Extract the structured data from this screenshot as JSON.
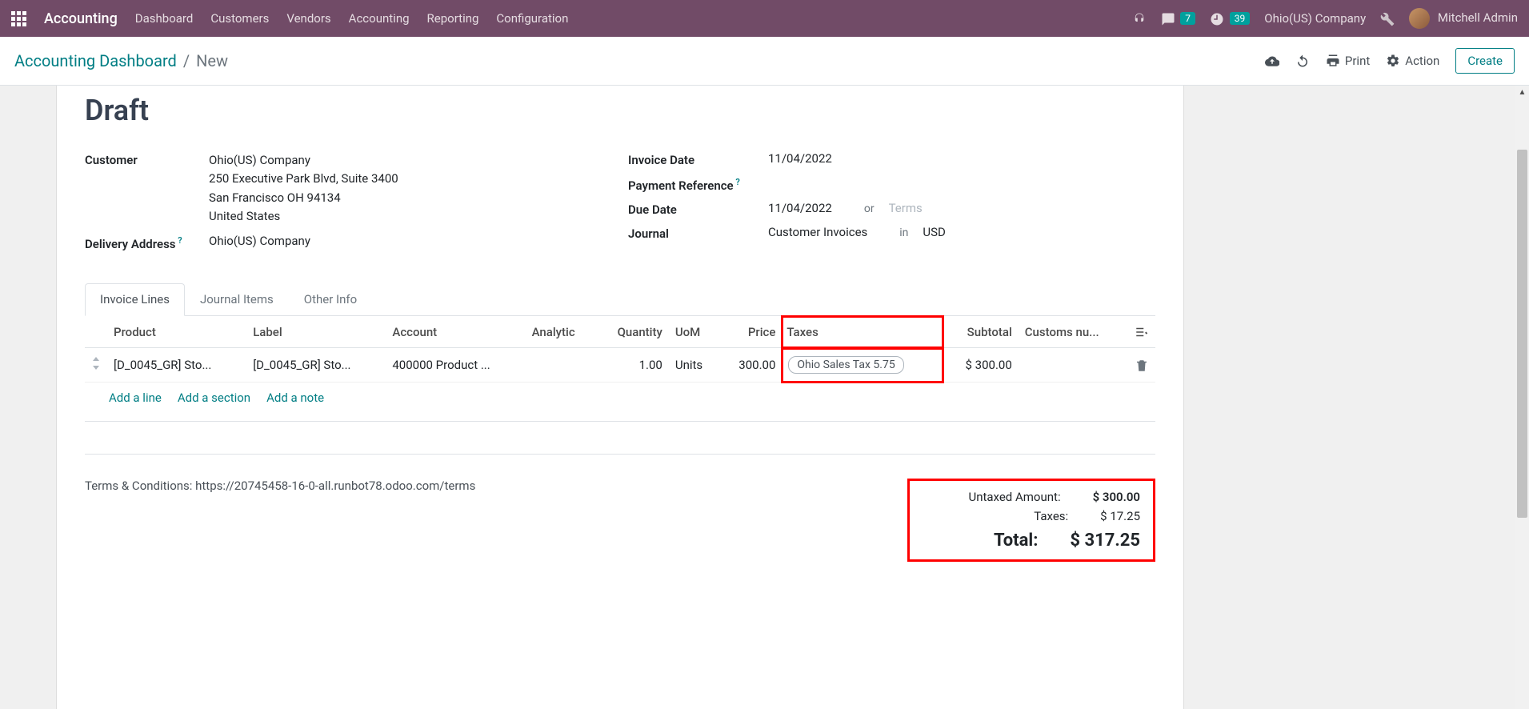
{
  "nav": {
    "app_title": "Accounting",
    "menus": [
      "Dashboard",
      "Customers",
      "Vendors",
      "Accounting",
      "Reporting",
      "Configuration"
    ],
    "chat_badge": "7",
    "clock_badge": "39",
    "company": "Ohio(US) Company",
    "user": "Mitchell Admin"
  },
  "control": {
    "breadcrumb_root": "Accounting Dashboard",
    "breadcrumb_current": "New",
    "print": "Print",
    "action": "Action",
    "create": "Create"
  },
  "doc": {
    "title": "Draft",
    "left": {
      "customer_label": "Customer",
      "customer_name": "Ohio(US) Company",
      "addr1": "250 Executive Park Blvd, Suite 3400",
      "addr2": "San Francisco OH 94134",
      "addr3": "United States",
      "delivery_label": "Delivery Address",
      "delivery_value": "Ohio(US) Company"
    },
    "right": {
      "invoice_date_label": "Invoice Date",
      "invoice_date": "11/04/2022",
      "payref_label": "Payment Reference",
      "due_label": "Due Date",
      "due_date": "11/04/2022",
      "or": "or",
      "terms_ph": "Terms",
      "journal_label": "Journal",
      "journal_value": "Customer Invoices",
      "in": "in",
      "currency": "USD"
    }
  },
  "tabs": [
    "Invoice Lines",
    "Journal Items",
    "Other Info"
  ],
  "table": {
    "headers": {
      "product": "Product",
      "label": "Label",
      "account": "Account",
      "analytic": "Analytic",
      "qty": "Quantity",
      "uom": "UoM",
      "price": "Price",
      "taxes": "Taxes",
      "subtotal": "Subtotal",
      "customs": "Customs nu..."
    },
    "row": {
      "product": "[D_0045_GR] Sto...",
      "label": "[D_0045_GR] Sto...",
      "account": "400000 Product ...",
      "analytic": "",
      "qty": "1.00",
      "uom": "Units",
      "price": "300.00",
      "tax": "Ohio Sales Tax 5.75",
      "subtotal": "$ 300.00"
    },
    "add_line": "Add a line",
    "add_section": "Add a section",
    "add_note": "Add a note"
  },
  "footer": {
    "terms": "Terms & Conditions: https://20745458-16-0-all.runbot78.odoo.com/terms",
    "untaxed_label": "Untaxed Amount:",
    "untaxed": "$ 300.00",
    "taxes_label": "Taxes:",
    "taxes": "$ 17.25",
    "total_label": "Total:",
    "total": "$ 317.25"
  }
}
